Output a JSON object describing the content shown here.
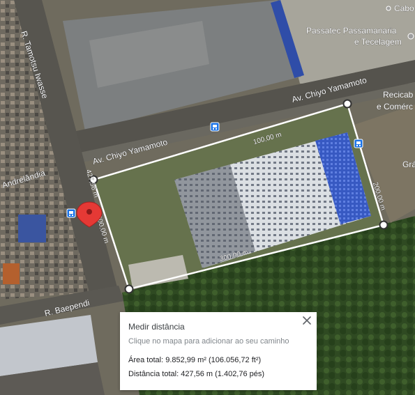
{
  "roads": {
    "chiyo_upper": "Av. Chiyo Yamamoto",
    "chiyo_lower": "Av. Chiyo Yamamoto",
    "tamotsu": "R. Tamotsu Iwasse",
    "baependi": "R. Baependi",
    "andrelandia": "Andrelândia"
  },
  "pois": {
    "passatec_line1": "Passatec Passamanaria",
    "passatec_line2": "e Tecelagem",
    "cabo": "Cabo",
    "recicab_line1": "Recicab",
    "recicab_line2": "e Comérc",
    "gra": "Grá"
  },
  "segments": {
    "top": "100,00 m",
    "right": "200,00 m",
    "bottom": "300,00 m",
    "left": "400,00 m",
    "first": "427,56 m"
  },
  "panel": {
    "title": "Medir distância",
    "subtitle": "Clique no mapa para adicionar ao seu caminho",
    "area": "Área total: 9.852,99 m² (106.056,72 ft²)",
    "distance": "Distância total: 427,56 m (1.402,76 pés)"
  },
  "icons": {
    "close": "close-icon",
    "marker": "location-pin-icon",
    "bus_stop": "bus-stop-icon"
  },
  "colors": {
    "marker": "#e53935",
    "measure_line": "#ffffff",
    "bus_stop": "#1a73e8"
  }
}
